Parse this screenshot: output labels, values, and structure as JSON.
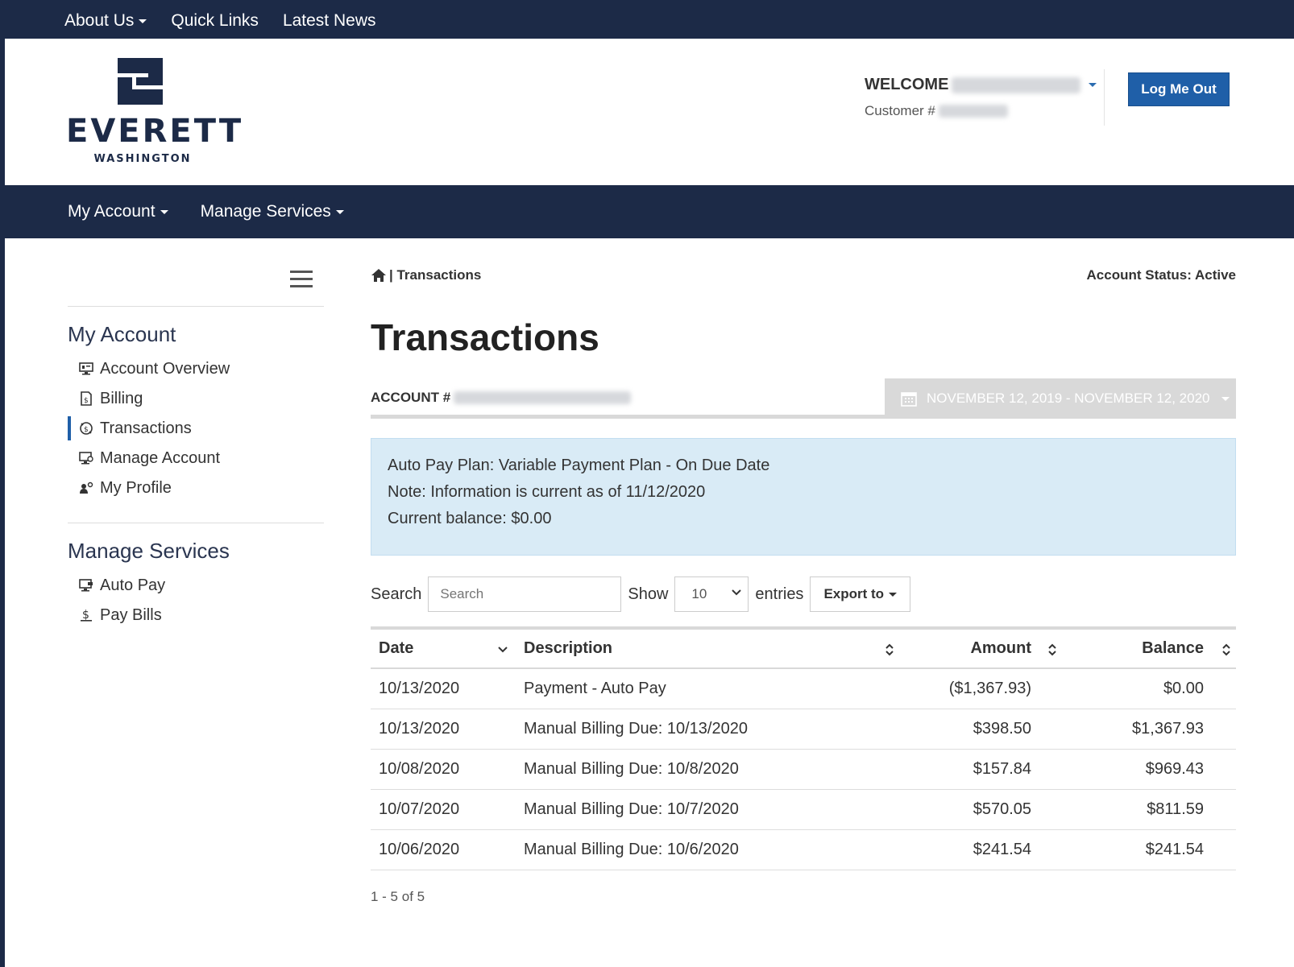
{
  "topbar": {
    "about_label": "About Us",
    "quick_links_label": "Quick Links",
    "latest_news_label": "Latest News"
  },
  "header": {
    "logo_text": "EVERETT",
    "logo_sub": "WASHINGTON",
    "welcome_label": "WELCOME",
    "customer_label": "Customer #",
    "logout_label": "Log Me Out"
  },
  "mainnav": {
    "my_account_label": "My Account",
    "manage_services_label": "Manage Services"
  },
  "sidebar": {
    "my_account_heading": "My Account",
    "my_account_items": [
      {
        "label": "Account Overview",
        "icon": "monitor-icon"
      },
      {
        "label": "Billing",
        "icon": "bill-icon"
      },
      {
        "label": "Transactions",
        "icon": "transactions-icon"
      },
      {
        "label": "Manage Account",
        "icon": "desktop-settings-icon"
      },
      {
        "label": "My Profile",
        "icon": "user-gear-icon"
      }
    ],
    "manage_services_heading": "Manage Services",
    "manage_services_items": [
      {
        "label": "Auto Pay",
        "icon": "autopay-icon"
      },
      {
        "label": "Pay Bills",
        "icon": "dollar-icon"
      }
    ]
  },
  "content": {
    "breadcrumb": "| Transactions",
    "account_status": "Account Status: Active",
    "page_title": "Transactions",
    "account_label": "ACCOUNT #",
    "date_range": "NOVEMBER 12, 2019 - NOVEMBER 12, 2020",
    "info": {
      "line1": "Auto Pay Plan: Variable Payment Plan - On Due Date",
      "line2": "Note: Information is current as of 11/12/2020",
      "line3": "Current balance: $0.00"
    },
    "controls": {
      "search_label": "Search",
      "search_placeholder": "Search",
      "show_label": "Show",
      "show_value": "10",
      "entries_label": "entries",
      "export_label": "Export to"
    },
    "table": {
      "headers": {
        "date": "Date",
        "description": "Description",
        "amount": "Amount",
        "balance": "Balance"
      },
      "rows": [
        {
          "date": "10/13/2020",
          "description": "Payment - Auto Pay",
          "amount": "($1,367.93)",
          "balance": "$0.00"
        },
        {
          "date": "10/13/2020",
          "description": "Manual Billing Due: 10/13/2020",
          "amount": "$398.50",
          "balance": "$1,367.93"
        },
        {
          "date": "10/08/2020",
          "description": "Manual Billing Due: 10/8/2020",
          "amount": "$157.84",
          "balance": "$969.43"
        },
        {
          "date": "10/07/2020",
          "description": "Manual Billing Due: 10/7/2020",
          "amount": "$570.05",
          "balance": "$811.59"
        },
        {
          "date": "10/06/2020",
          "description": "Manual Billing Due: 10/6/2020",
          "amount": "$241.54",
          "balance": "$241.54"
        }
      ]
    },
    "pager": "1 - 5 of 5"
  },
  "colors": {
    "navy": "#1c2a47",
    "accent_blue": "#1f5fa8",
    "info_bg": "#d9ebf6",
    "date_bar": "#d9d9d9"
  }
}
